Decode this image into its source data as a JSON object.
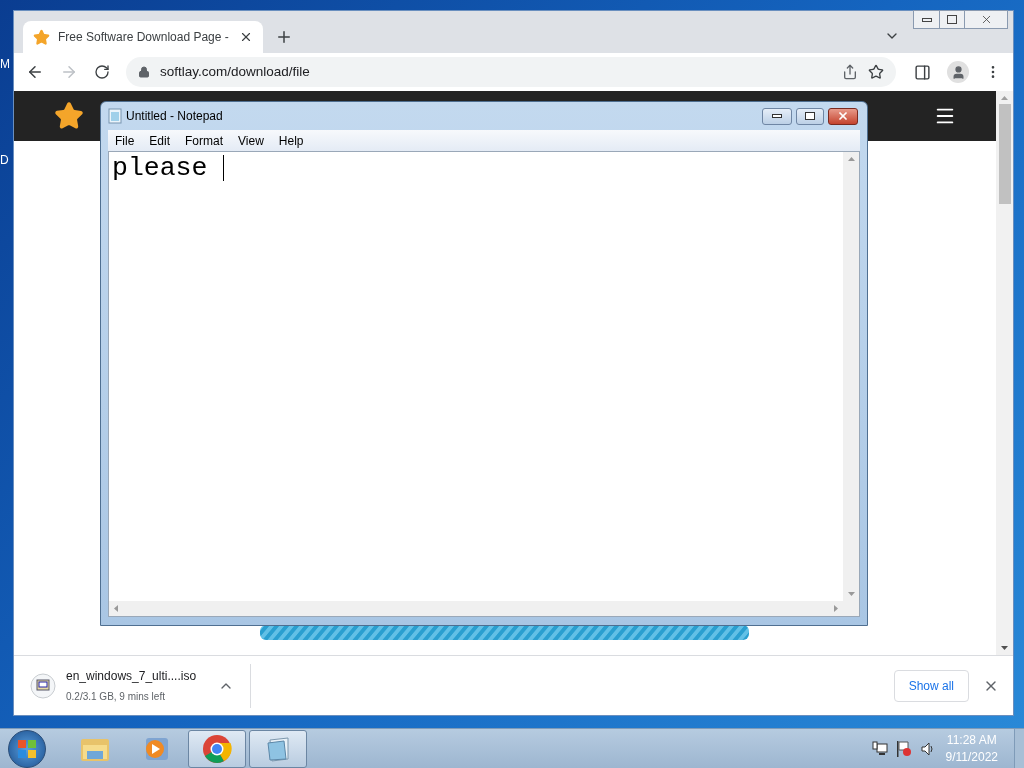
{
  "desktop": {
    "icon_labels": [
      "M",
      "D"
    ]
  },
  "browser": {
    "tabs": [
      {
        "title": "Free Software Download Page - ",
        "selected": true
      }
    ],
    "address": "softlay.com/download/file",
    "downloads": [
      {
        "name": "en_windows_7_ulti....iso",
        "status": "0.2/3.1 GB, 9 mins left"
      }
    ],
    "show_all": "Show all"
  },
  "notepad": {
    "title": "Untitled - Notepad",
    "menu": [
      "File",
      "Edit",
      "Format",
      "View",
      "Help"
    ],
    "text": "please "
  },
  "taskbar": {
    "apps": [
      {
        "kind": "explorer",
        "running": false
      },
      {
        "kind": "media",
        "running": false
      },
      {
        "kind": "chrome",
        "running": true
      },
      {
        "kind": "notepad",
        "running": true
      }
    ],
    "time": "11:28 AM",
    "date": "9/11/2022"
  }
}
